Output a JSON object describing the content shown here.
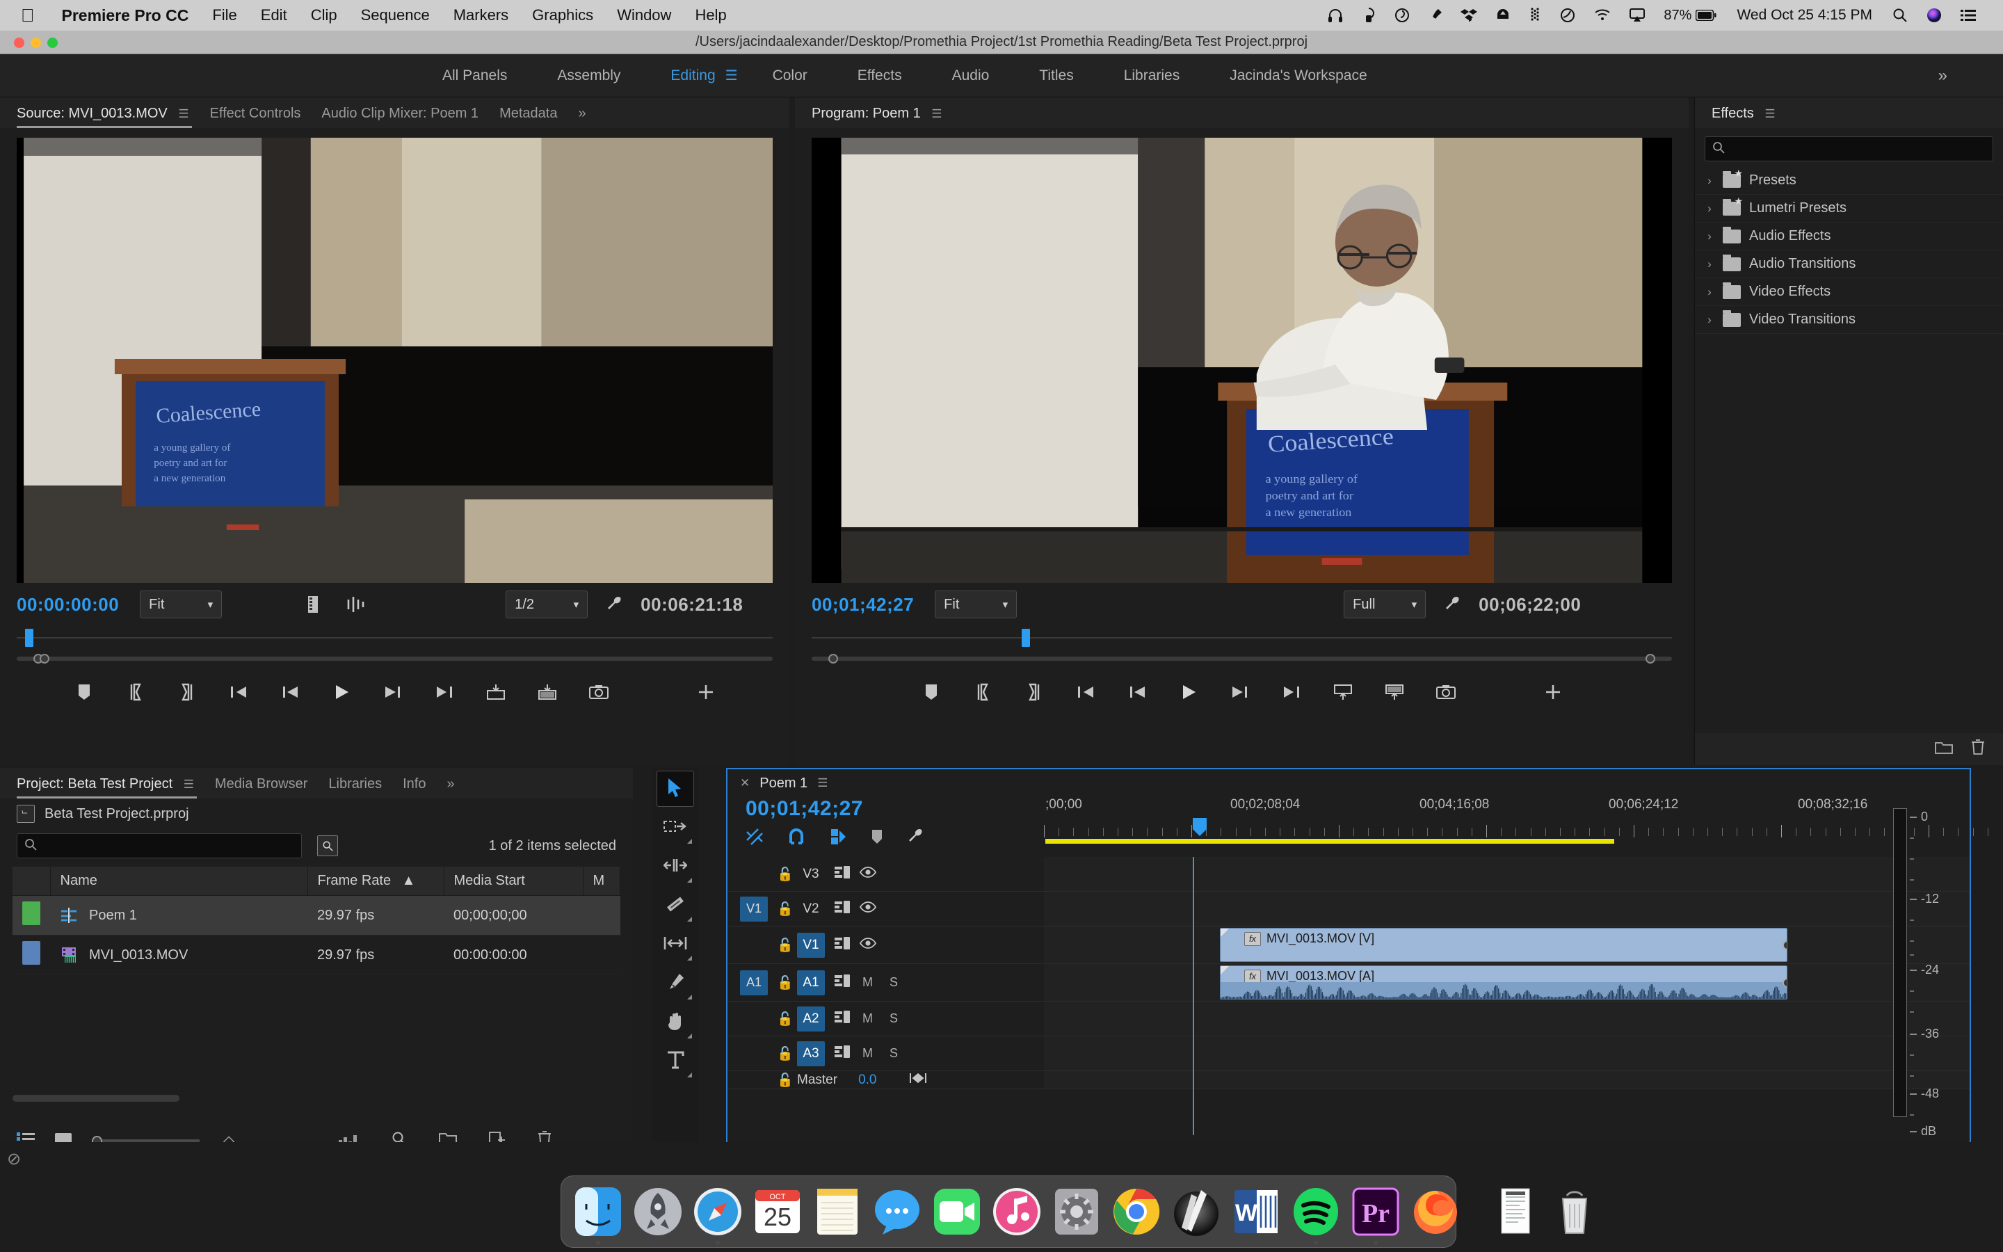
{
  "menubar": {
    "apple_icon": "apple-icon",
    "items": [
      "Premiere Pro CC",
      "File",
      "Edit",
      "Clip",
      "Sequence",
      "Markers",
      "Graphics",
      "Window",
      "Help"
    ],
    "status_icons": [
      "headphones-icon",
      "airdrop-icon",
      "creative-cloud-icon",
      "flashlight-icon",
      "dropbox-icon",
      "backblaze-icon",
      "grid-icon",
      "onedrive-icon",
      "wifi-icon",
      "airplay-icon"
    ],
    "battery_percent": "87%",
    "clock": "Wed Oct 25  4:15 PM",
    "spotlight_icon": "search-icon",
    "siri_icon": "siri-icon",
    "notification_icon": "list-icon"
  },
  "titlebar": {
    "path": "/Users/jacindaalexander/Desktop/Promethia Project/1st Promethia Reading/Beta Test Project.prproj"
  },
  "workspace": {
    "tabs": [
      "All Panels",
      "Assembly",
      "Editing",
      "Color",
      "Effects",
      "Audio",
      "Titles",
      "Libraries",
      "Jacinda's Workspace"
    ],
    "active": "Editing",
    "overflow": "»"
  },
  "source_monitor": {
    "tabs": [
      "Source: MVI_0013.MOV",
      "Effect Controls",
      "Audio Clip Mixer: Poem 1",
      "Metadata"
    ],
    "active_tab": "Source: MVI_0013.MOV",
    "overflow": "»",
    "playhead_timecode": "00:00:00:00",
    "fit_value": "Fit",
    "quality_value": "1/2",
    "duration": "00:06:21:18",
    "buttons": [
      "add-marker",
      "mark-in",
      "mark-out",
      "go-to-in",
      "step-back",
      "play-stop",
      "step-forward",
      "go-to-out",
      "insert",
      "overwrite",
      "export-frame",
      "button-editor"
    ]
  },
  "program_monitor": {
    "tab": "Program: Poem 1",
    "playhead_timecode": "00;01;42;27",
    "fit_value": "Fit",
    "quality_value": "Full",
    "duration": "00;06;22;00",
    "buttons": [
      "add-marker",
      "mark-in",
      "mark-out",
      "go-to-in",
      "step-back",
      "play-stop",
      "step-forward",
      "go-to-out",
      "lift",
      "extract",
      "export-frame",
      "button-editor"
    ]
  },
  "effects_panel": {
    "title": "Effects",
    "search_placeholder": "",
    "search_value": "",
    "items": [
      {
        "label": "Presets",
        "icon": "preset-folder-icon"
      },
      {
        "label": "Lumetri Presets",
        "icon": "preset-folder-icon"
      },
      {
        "label": "Audio Effects",
        "icon": "folder-icon"
      },
      {
        "label": "Audio Transitions",
        "icon": "folder-icon"
      },
      {
        "label": "Video Effects",
        "icon": "folder-icon"
      },
      {
        "label": "Video Transitions",
        "icon": "folder-icon"
      }
    ]
  },
  "project_panel": {
    "tabs": [
      "Project: Beta Test Project",
      "Media Browser",
      "Libraries",
      "Info"
    ],
    "active_tab": "Project: Beta Test Project",
    "overflow": "»",
    "project_file": "Beta Test Project.prproj",
    "search_value": "",
    "selection_status": "1 of 2 items selected",
    "columns": [
      "",
      "Name",
      "Frame Rate",
      "Media Start",
      "M"
    ],
    "sort_column": "Frame Rate",
    "rows": [
      {
        "swatch": "#4cb050",
        "icon": "sequence-icon",
        "name": "Poem 1",
        "frame_rate": "29.97 fps",
        "media_start": "00;00;00;00",
        "selected": true
      },
      {
        "swatch": "#5a82bb",
        "icon": "video-clip-icon",
        "name": "MVI_0013.MOV",
        "frame_rate": "29.97 fps",
        "media_start": "00:00:00:00",
        "selected": false
      }
    ]
  },
  "tools": [
    {
      "name": "selection-tool",
      "glyph": "selection-arrow-icon",
      "active": true
    },
    {
      "name": "track-select-forward-tool",
      "glyph": "track-select-icon",
      "active": false
    },
    {
      "name": "ripple-edit-tool",
      "glyph": "ripple-edit-icon",
      "active": false
    },
    {
      "name": "razor-tool",
      "glyph": "razor-icon",
      "active": false
    },
    {
      "name": "slip-tool",
      "glyph": "slip-icon",
      "active": false
    },
    {
      "name": "pen-tool",
      "glyph": "pen-icon",
      "active": false
    },
    {
      "name": "hand-tool",
      "glyph": "hand-icon",
      "active": false
    },
    {
      "name": "type-tool",
      "glyph": "type-icon",
      "active": false
    }
  ],
  "timeline": {
    "tab_label": "Poem 1",
    "playhead_timecode": "00;01;42;27",
    "tool_icons": [
      "linked-selection-icon",
      "snap-icon",
      "marker-sync-icon",
      "marker-icon",
      "settings-wrench-icon"
    ],
    "ruler_labels": [
      ";00;00",
      "00;02;08;04",
      "00;04;16;08",
      "00;06;24;12",
      "00;08;32;16"
    ],
    "tracks": [
      {
        "source": "",
        "name": "V3",
        "type": "video",
        "targeted": false,
        "clip": null
      },
      {
        "source": "V1",
        "name": "V2",
        "type": "video",
        "targeted": false,
        "clip": null
      },
      {
        "source": "",
        "name": "V1",
        "type": "video",
        "targeted": true,
        "clip": {
          "label": "MVI_0013.MOV [V]",
          "fx": "fx"
        }
      },
      {
        "source": "A1",
        "name": "A1",
        "type": "audio",
        "targeted": true,
        "mute": "M",
        "solo": "S",
        "clip": {
          "label": "MVI_0013.MOV [A]",
          "fx": "fx"
        }
      },
      {
        "source": "",
        "name": "A2",
        "type": "audio",
        "targeted": true,
        "mute": "M",
        "solo": "S",
        "clip": null
      },
      {
        "source": "",
        "name": "A3",
        "type": "audio",
        "targeted": true,
        "mute": "M",
        "solo": "S",
        "clip": null
      },
      {
        "source": "",
        "name": "Master",
        "type": "master",
        "level": "0.0",
        "clip": null
      }
    ],
    "meter_labels": [
      "0",
      "-12",
      "-24",
      "-36",
      "-48",
      "dB"
    ]
  },
  "dock": {
    "items": [
      {
        "name": "finder",
        "label": "Finder",
        "running": true
      },
      {
        "name": "launchpad",
        "label": "Launchpad",
        "running": false
      },
      {
        "name": "safari",
        "label": "Safari",
        "running": true
      },
      {
        "name": "calendar",
        "label": "Calendar",
        "month": "OCT",
        "day": "25",
        "running": false
      },
      {
        "name": "notes",
        "label": "Notes",
        "running": false
      },
      {
        "name": "messages",
        "label": "Messages",
        "running": false
      },
      {
        "name": "facetime",
        "label": "FaceTime",
        "running": false
      },
      {
        "name": "itunes",
        "label": "iTunes",
        "running": false
      },
      {
        "name": "system-preferences",
        "label": "System Preferences",
        "running": false
      },
      {
        "name": "chrome",
        "label": "Google Chrome",
        "running": false
      },
      {
        "name": "final-cut",
        "label": "Final Cut",
        "running": false
      },
      {
        "name": "word",
        "label": "Microsoft Word",
        "running": false
      },
      {
        "name": "spotify",
        "label": "Spotify",
        "running": true
      },
      {
        "name": "premiere-pro",
        "label": "Premiere Pro",
        "running": true
      },
      {
        "name": "firefox",
        "label": "Firefox",
        "running": false
      },
      {
        "name": "documents-stack",
        "label": "Documents",
        "running": false
      },
      {
        "name": "trash",
        "label": "Trash",
        "running": false
      }
    ]
  },
  "colors": {
    "accent_blue": "#2e9cf0",
    "work_area_yellow": "#e9e400",
    "clip_blue": "#9db8d8",
    "target_blue": "#1f5c8f",
    "panel_bg": "#1e1e1e"
  }
}
